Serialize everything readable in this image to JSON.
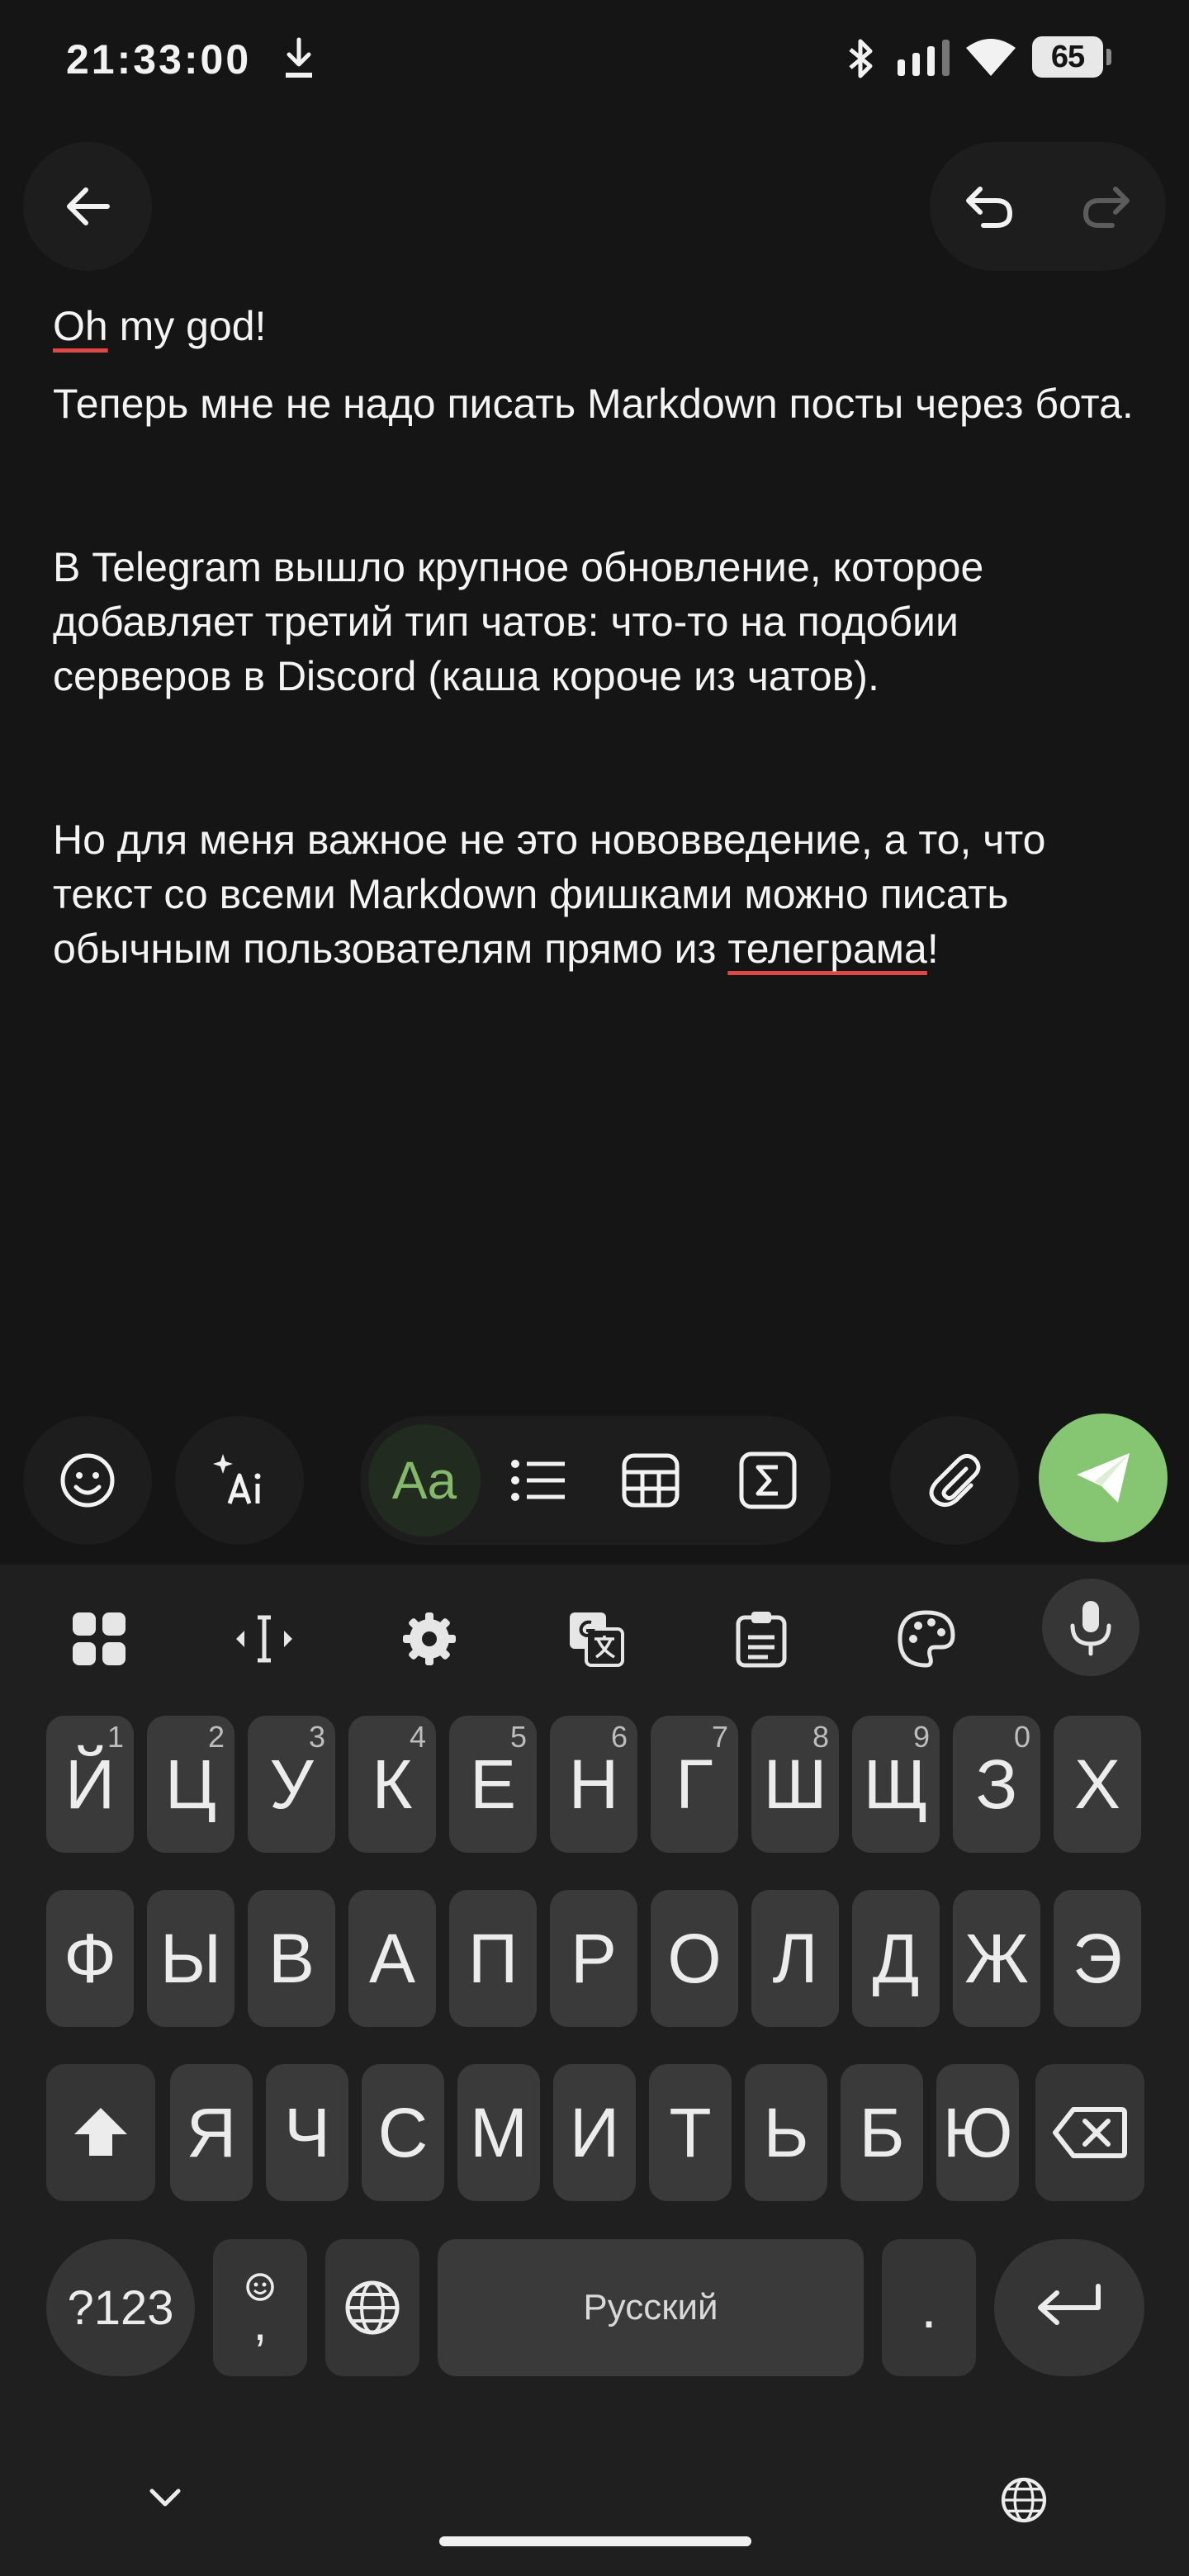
{
  "status_bar": {
    "time": "21:33:00",
    "battery": "65",
    "icons": [
      "download-icon",
      "bluetooth-icon",
      "signal-icon",
      "wifi-icon",
      "battery-icon"
    ]
  },
  "header": {
    "icons": [
      "back-arrow-icon",
      "undo-icon",
      "redo-icon"
    ]
  },
  "message": {
    "line1_word": "Oh",
    "line1_rest": " my god!",
    "para1": "Теперь мне не надо писать Markdown посты через бота.",
    "para2": "В Telegram вышло крупное обновление, которое добавляет третий тип чатов: что-то на подобии серверов в Discord (каша короче из чатов).",
    "para3_start": "Но для меня важное не это нововведение, а то, что текст со всеми Markdown фишками можно писать обычным пользователям прямо из ",
    "para3_word": "телеграма",
    "para3_end": "!"
  },
  "toolbar": {
    "format_text_label": "Aa",
    "icons": [
      "emoji-icon",
      "ai-sparkle-icon",
      "list-icon",
      "table-icon",
      "formula-icon",
      "attach-icon",
      "send-icon"
    ],
    "accent_color": "#86c571"
  },
  "keyboard": {
    "top_icons": [
      "apps-grid-icon",
      "cursor-icon",
      "settings-icon",
      "translate-icon",
      "clipboard-icon",
      "palette-icon",
      "mic-icon"
    ],
    "row1": [
      {
        "label": "Й",
        "hint": "1"
      },
      {
        "label": "Ц",
        "hint": "2"
      },
      {
        "label": "У",
        "hint": "3"
      },
      {
        "label": "К",
        "hint": "4"
      },
      {
        "label": "Е",
        "hint": "5"
      },
      {
        "label": "Н",
        "hint": "6"
      },
      {
        "label": "Г",
        "hint": "7"
      },
      {
        "label": "Ш",
        "hint": "8"
      },
      {
        "label": "Щ",
        "hint": "9"
      },
      {
        "label": "З",
        "hint": "0"
      },
      {
        "label": "Х",
        "hint": ""
      }
    ],
    "row2": [
      "Ф",
      "Ы",
      "В",
      "А",
      "П",
      "Р",
      "О",
      "Л",
      "Д",
      "Ж",
      "Э"
    ],
    "row3": [
      "Я",
      "Ч",
      "С",
      "М",
      "И",
      "Т",
      "Ь",
      "Б",
      "Ю"
    ],
    "numbers_label": "?123",
    "comma_label": ",",
    "space_label": "Русский",
    "period_label": "."
  }
}
